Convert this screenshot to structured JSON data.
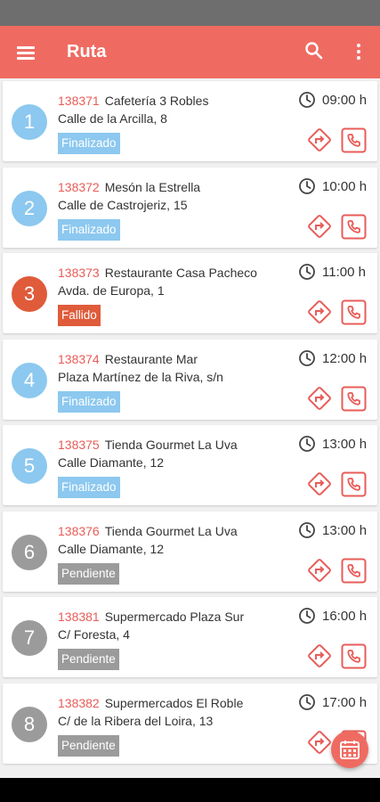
{
  "app_bar": {
    "title": "Ruta",
    "menu_icon": "menu-icon",
    "search_icon": "search-icon",
    "more_icon": "more-vert-icon",
    "color": "#ef6b62"
  },
  "status_colors": {
    "Finalizado": "#8cc8ef",
    "Fallido": "#df5b3a",
    "Pendiente": "#9b9b9b",
    "accent": "#e85c58"
  },
  "stops": [
    {
      "number": "1",
      "code": "138371",
      "name": "Cafetería 3 Robles",
      "address": "Calle de la Arcilla, 8",
      "status": "Finalizado",
      "time": "09:00 h"
    },
    {
      "number": "2",
      "code": "138372",
      "name": "Mesón la Estrella",
      "address": "Calle de Castrojeriz, 15",
      "status": "Finalizado",
      "time": "10:00 h"
    },
    {
      "number": "3",
      "code": "138373",
      "name": "Restaurante Casa Pacheco",
      "address": "Avda. de Europa, 1",
      "status": "Fallido",
      "time": "11:00 h"
    },
    {
      "number": "4",
      "code": "138374",
      "name": "Restaurante Mar",
      "address": "Plaza Martínez de la Riva, s/n",
      "status": "Finalizado",
      "time": "12:00 h"
    },
    {
      "number": "5",
      "code": "138375",
      "name": "Tienda Gourmet La Uva",
      "address": "Calle Diamante, 12",
      "status": "Finalizado",
      "time": "13:00 h"
    },
    {
      "number": "6",
      "code": "138376",
      "name": "Tienda Gourmet La Uva",
      "address": "Calle Diamante, 12",
      "status": "Pendiente",
      "time": "13:00 h"
    },
    {
      "number": "7",
      "code": "138381",
      "name": "Supermercado Plaza Sur",
      "address": "C/ Foresta, 4",
      "status": "Pendiente",
      "time": "16:00 h"
    },
    {
      "number": "8",
      "code": "138382",
      "name": "Supermercados El Roble",
      "address": "C/ de la Ribera del Loira, 13",
      "status": "Pendiente",
      "time": "17:00 h"
    }
  ],
  "icons": {
    "clock": "clock-icon",
    "directions": "directions-icon",
    "phone": "phone-icon",
    "fab": "calendar-icon"
  }
}
